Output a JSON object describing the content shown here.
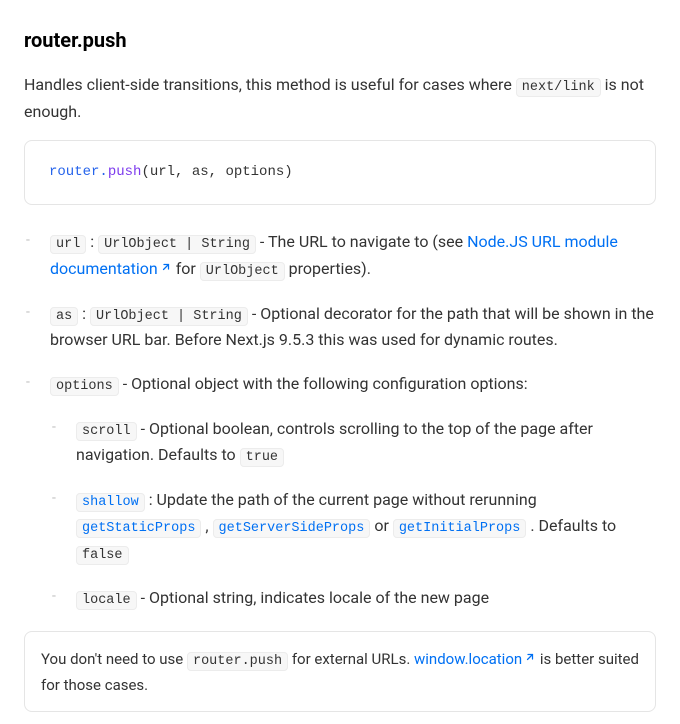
{
  "heading": "router.push",
  "intro": {
    "before": "Handles client-side transitions, this method is useful for cases where ",
    "code": "next/link",
    "after": " is not enough."
  },
  "codeblock": {
    "obj": "router",
    "dot": ".",
    "fn": "push",
    "args": "(url, as, options)"
  },
  "params": {
    "url": {
      "name": "url",
      "type_sep": " : ",
      "type": "UrlObject | String",
      "desc_before": " - The URL to navigate to (see ",
      "link_text": "Node.JS URL module documentation",
      "desc_mid": " for ",
      "urlObject": "UrlObject",
      "desc_after": " properties)."
    },
    "as": {
      "name": "as",
      "type_sep": " : ",
      "type": "UrlObject | String",
      "desc": " - Optional decorator for the path that will be shown in the browser URL bar. Before Next.js 9.5.3 this was used for dynamic routes."
    },
    "options": {
      "name": "options",
      "desc": " - Optional object with the following configuration options:",
      "scroll": {
        "name": "scroll",
        "desc_before": " - Optional boolean, controls scrolling to the top of the page after navigation. Defaults to ",
        "default": "true"
      },
      "shallow": {
        "name": "shallow",
        "desc_before": " : Update the path of the current page without rerunning ",
        "f1": "getStaticProps",
        "sep1": " , ",
        "f2": "getServerSideProps",
        "sep2": " or ",
        "f3": "getInitialProps",
        "desc_after": " . Defaults to ",
        "default": "false"
      },
      "locale": {
        "name": "locale",
        "desc": " - Optional string, indicates locale of the new page"
      }
    }
  },
  "note": {
    "before": "You don't need to use ",
    "code": "router.push",
    "mid": " for external URLs. ",
    "link_text": "window.location",
    "after": " is better suited for those cases."
  }
}
